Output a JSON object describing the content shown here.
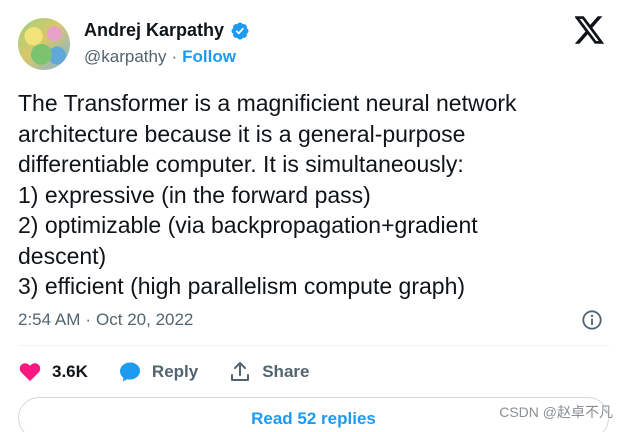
{
  "author": {
    "name": "Andrej Karpathy",
    "handle": "@karpathy",
    "separator": "·",
    "follow_label": "Follow"
  },
  "tweet": {
    "lines": [
      "The Transformer is a magnificient neural network",
      "architecture because it is a general-purpose",
      "differentiable computer. It is simultaneously:",
      "1) expressive (in the forward pass)",
      "2) optimizable (via backpropagation+gradient",
      "descent)",
      "3) efficient (high parallelism compute graph)"
    ],
    "time": "2:54 AM",
    "separator": "·",
    "date": "Oct 20, 2022"
  },
  "actions": {
    "like_count": "3.6K",
    "reply_label": "Reply",
    "share_label": "Share"
  },
  "replies_button_label": "Read 52 replies",
  "watermark": "CSDN @赵卓不凡",
  "colors": {
    "accent": "#1d9bf0",
    "like": "#f91880",
    "secondary_text": "#536471",
    "primary_text": "#0f1419"
  },
  "icons": [
    "verified-badge-icon",
    "x-logo-icon",
    "info-icon",
    "heart-icon",
    "reply-bubble-icon",
    "share-icon"
  ]
}
